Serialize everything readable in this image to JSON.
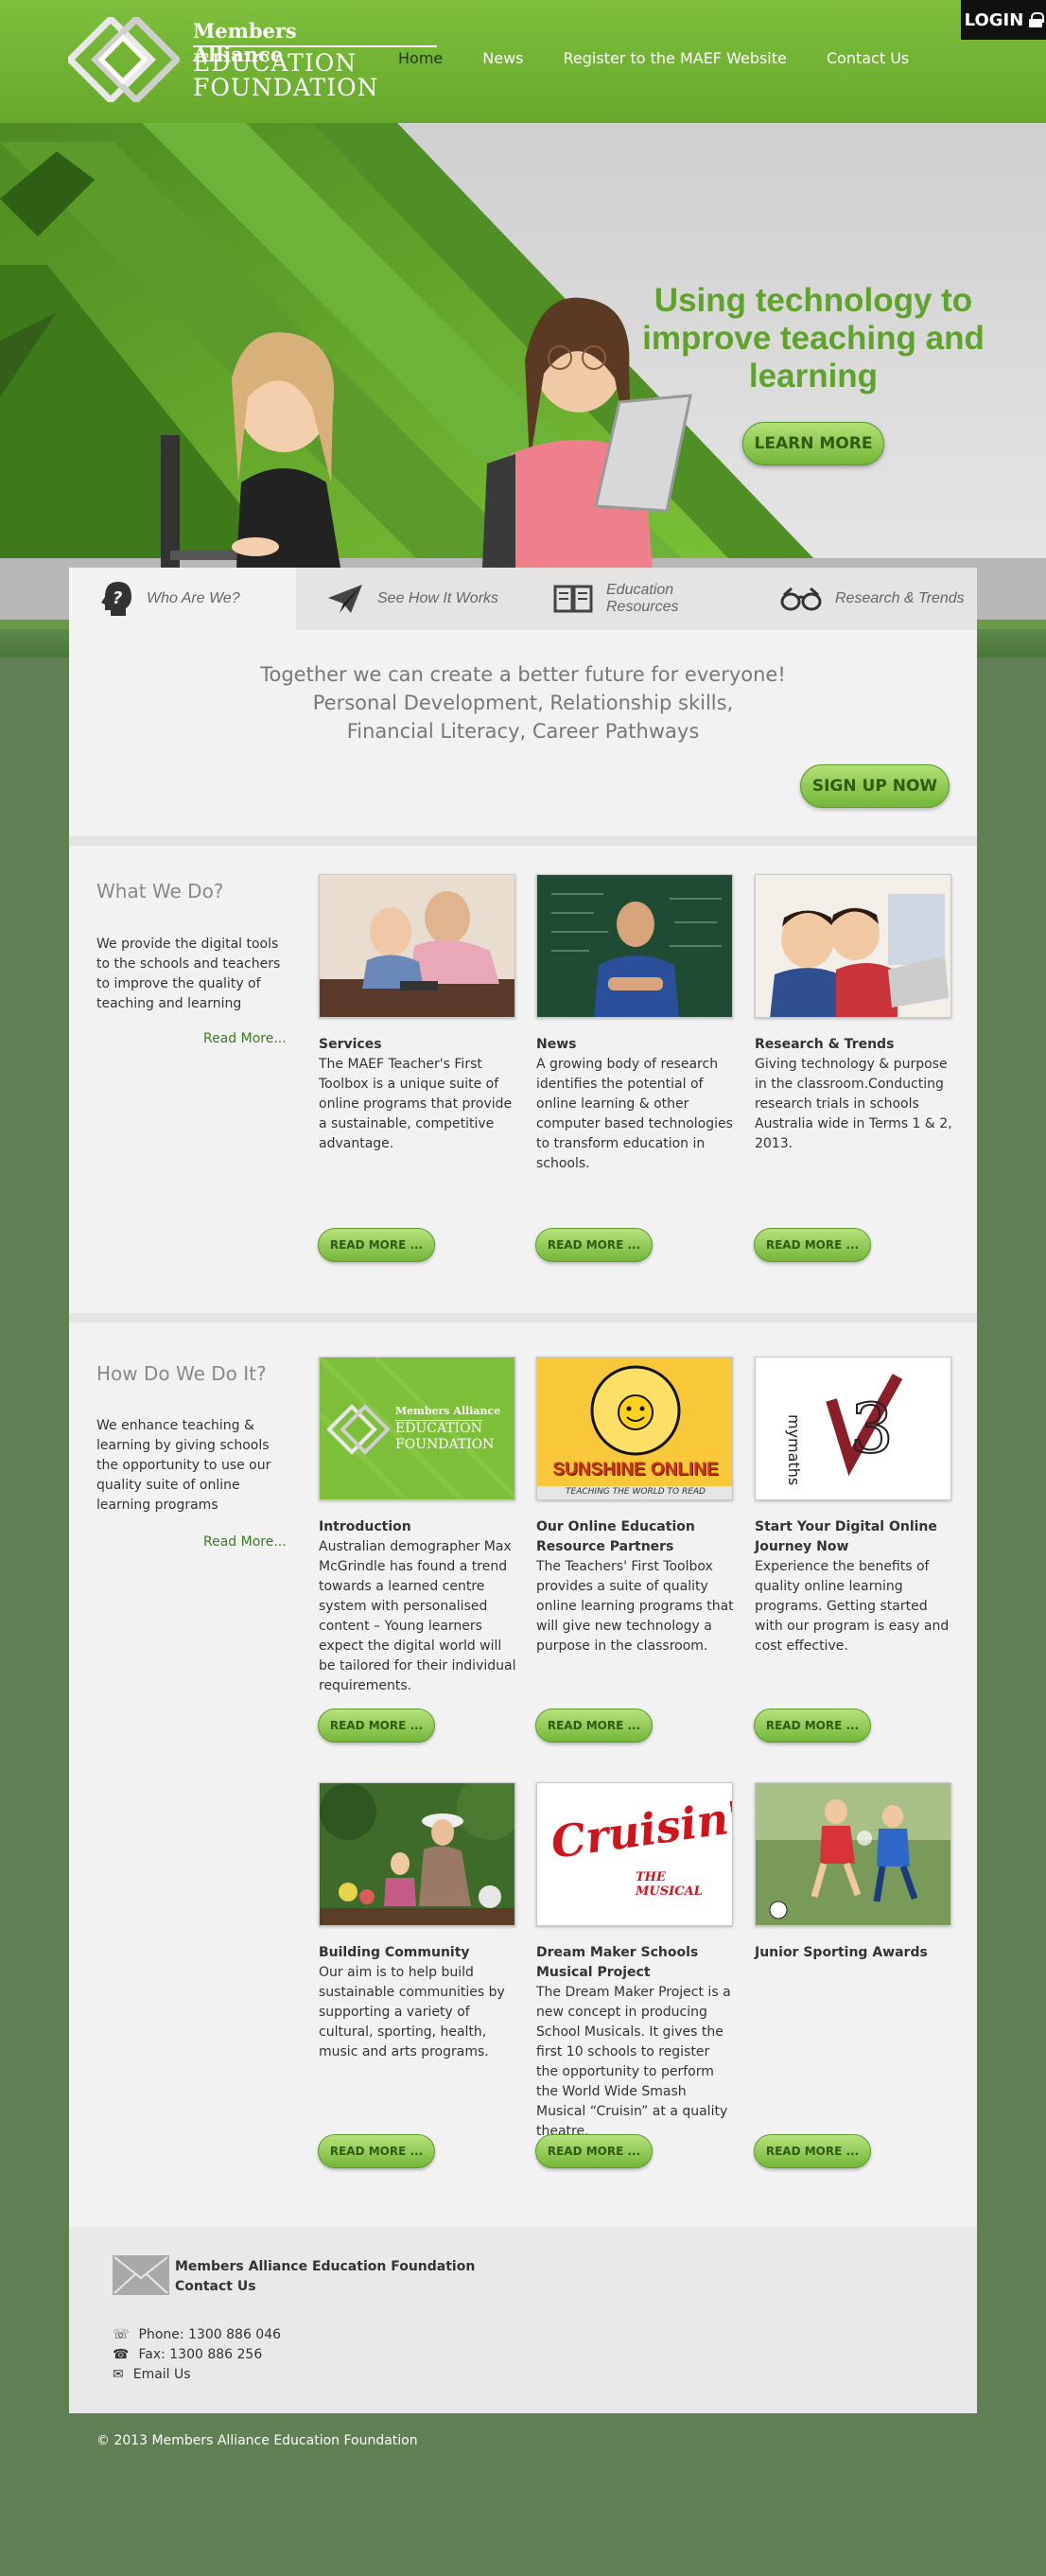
{
  "header": {
    "logo_line1": "Members Alliance",
    "logo_line2": "EDUCATION",
    "logo_line3": "FOUNDATION",
    "nav": [
      "Home",
      "News",
      "Register to the MAEF Website",
      "Contact Us"
    ],
    "login_label": "LOGIN"
  },
  "hero": {
    "title": "Using technology to improve teaching and learning",
    "button": "LEARN MORE"
  },
  "tabs": [
    {
      "label": "Who Are We?",
      "icon": "head-question-icon"
    },
    {
      "label": "See How It Works",
      "icon": "paper-plane-icon"
    },
    {
      "label": "Education Resources",
      "icon": "open-book-icon"
    },
    {
      "label": "Research & Trends",
      "icon": "glasses-icon"
    }
  ],
  "intro": {
    "line1": "Together we can create a better future for everyone!",
    "line2": "Personal Development, Relationship skills,",
    "line3": "Financial Literacy, Career Pathways",
    "signup": "SIGN UP NOW"
  },
  "what_we_do": {
    "title": "What We Do?",
    "text": "We provide the digital tools to the schools and teachers to improve the quality of teaching and learning",
    "more": "Read More...",
    "cards": [
      {
        "title": "Services",
        "desc": "The MAEF Teacher's First Toolbox is a unique suite of online programs that provide a sustainable, competitive advantage.",
        "button": "READ MORE ..."
      },
      {
        "title": "News",
        "desc": "A growing body of research identifies the potential of online learning & other computer based technologies to transform education in schools.",
        "button": "READ MORE ..."
      },
      {
        "title": "Research & Trends",
        "desc": "Giving technology & purpose in the classroom.Conducting research trials in schools Australia wide in Terms 1 & 2, 2013.",
        "button": "READ MORE ..."
      }
    ]
  },
  "how_we_do": {
    "title": "How Do We Do It?",
    "text": "We enhance teaching & learning by giving schools the opportunity to use our quality suite of online learning programs",
    "more": "Read More...",
    "cards": [
      {
        "title": "Introduction",
        "desc": "Australian demographer Max McGrindle has found a trend towards a learned centre system with personalised content – Young learners expect the digital world will be tailored for their individual requirements.",
        "button": "READ MORE ..."
      },
      {
        "title": "Our Online Education Resource Partners",
        "desc": "The Teachers' First Toolbox provides a suite of quality online learning programs that will give new technology a purpose in the classroom.",
        "button": "READ MORE ..."
      },
      {
        "title": "Start Your Digital Online Journey Now",
        "desc": "Experience the benefits of quality online learning programs. Getting started with our program is easy and cost effective.",
        "button": "READ MORE ..."
      },
      {
        "title": "Building Community",
        "desc": "Our aim is to help build sustainable communities by supporting a variety of cultural, sporting, health, music and arts programs.",
        "button": "READ MORE ..."
      },
      {
        "title": "Dream Maker Schools Musical Project",
        "desc": "The Dream Maker Project is a new concept in producing School Musicals. It gives the first 10 schools to register the opportunity to perform the World Wide Smash Musical “Cruisin” at a quality theatre.",
        "button": "READ MORE ..."
      },
      {
        "title": "Junior Sporting Awards",
        "desc": "",
        "button": "READ MORE ..."
      }
    ],
    "card_logo": {
      "line1": "Members Alliance",
      "line2": "EDUCATION",
      "line3": "FOUNDATION"
    },
    "sunshine": {
      "title": "SUNSHINE ONLINE",
      "tagline": "TEACHING THE WORLD TO READ"
    },
    "mymaths": "mymaths",
    "cruisin": {
      "title": "Cruisin'",
      "sub": "THE MUSICAL"
    }
  },
  "contact": {
    "org": "Members Alliance Education Foundation",
    "label": "Contact Us",
    "phone": "Phone: 1300 886 046",
    "fax": "Fax: 1300 886 256",
    "email": "Email Us"
  },
  "copyright": "© 2013 Members Alliance Education Foundation",
  "colors": {
    "brand_green": "#7fbf3d",
    "page_bg": "#617f55",
    "button_text": "#2f5b15"
  }
}
